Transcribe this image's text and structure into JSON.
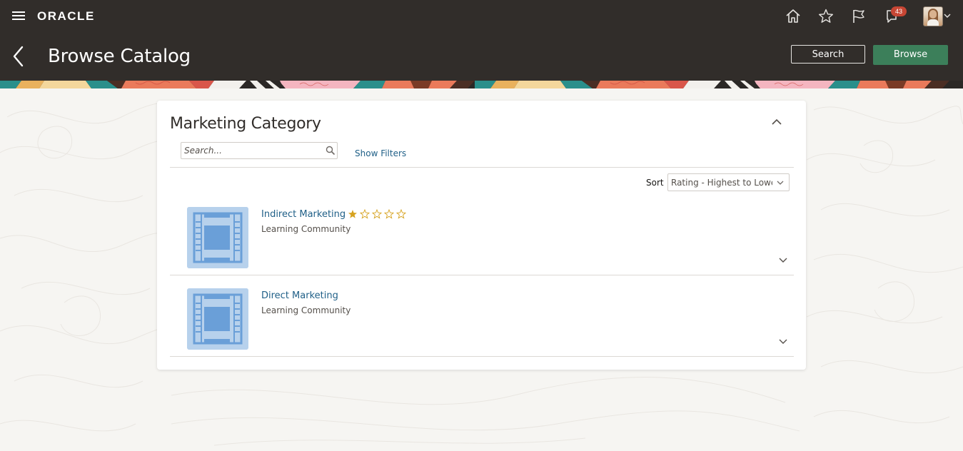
{
  "header": {
    "brand": "ORACLE",
    "notification_count": "43",
    "page_title": "Browse Catalog",
    "search_button_label": "Search",
    "browse_button_label": "Browse"
  },
  "card": {
    "title": "Marketing Category",
    "search": {
      "placeholder": "Search...",
      "value": ""
    },
    "show_filters_label": "Show Filters",
    "sort": {
      "label": "Sort",
      "selected": "Rating - Highest to Lowest"
    },
    "items": [
      {
        "title": "Indirect Marketing",
        "subtitle": "Learning Community",
        "rating": 1,
        "rating_max": 5
      },
      {
        "title": "Direct Marketing",
        "subtitle": "Learning Community"
      }
    ]
  },
  "colors": {
    "header_background": "#312d2a",
    "primary_button": "#3c7f5a",
    "link": "#1f5f87",
    "badge": "#c74634",
    "star": "#d6a21f",
    "thumbnail": "#b7d1ec"
  }
}
